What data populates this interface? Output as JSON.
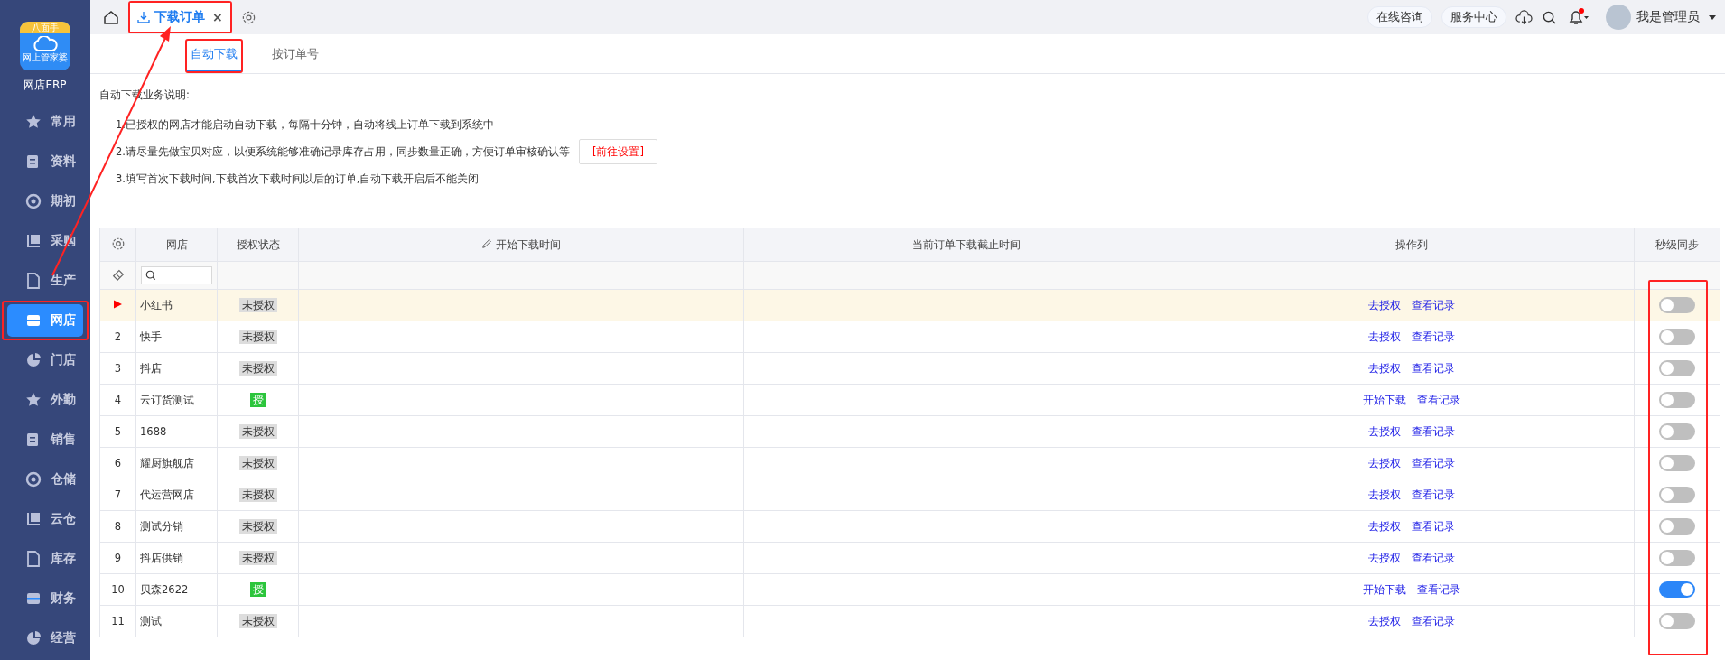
{
  "sidebar": {
    "logo": {
      "badge": "八面手",
      "caption": "网上管家婆"
    },
    "app_name": "网店ERP",
    "items": [
      {
        "label": "常用",
        "selected": false,
        "highlighted": false
      },
      {
        "label": "资料",
        "selected": false,
        "highlighted": false
      },
      {
        "label": "期初",
        "selected": false,
        "highlighted": false
      },
      {
        "label": "采购",
        "selected": false,
        "highlighted": false
      },
      {
        "label": "生产",
        "selected": false,
        "highlighted": false
      },
      {
        "label": "网店",
        "selected": true,
        "highlighted": true
      },
      {
        "label": "门店",
        "selected": false,
        "highlighted": false
      },
      {
        "label": "外勤",
        "selected": false,
        "highlighted": false
      },
      {
        "label": "销售",
        "selected": false,
        "highlighted": false
      },
      {
        "label": "仓储",
        "selected": false,
        "highlighted": false
      },
      {
        "label": "云仓",
        "selected": false,
        "highlighted": false
      },
      {
        "label": "库存",
        "selected": false,
        "highlighted": false
      },
      {
        "label": "财务",
        "selected": false,
        "highlighted": false
      },
      {
        "label": "经营",
        "selected": false,
        "highlighted": false
      }
    ]
  },
  "header": {
    "tabs": [
      {
        "label": "下载订单",
        "close": "×",
        "selected": true,
        "highlighted": true
      }
    ],
    "buttons": [
      "在线咨询",
      "服务中心"
    ],
    "notification_dot": true,
    "user": "我是管理员"
  },
  "subtabs": [
    {
      "label": "自动下载",
      "selected": true,
      "highlighted": true
    },
    {
      "label": "按订单号",
      "selected": false,
      "highlighted": false
    }
  ],
  "instructions": {
    "title": "自动下载业务说明:",
    "items": [
      {
        "text": "1.已授权的网店才能启动自动下载，每隔十分钟，自动将线上订单下载到系统中"
      },
      {
        "text": "2.请尽量先做宝贝对应，以便系统能够准确记录库存占用，同步数量正确，方便订单审核确认等",
        "button": "[前往设置]"
      },
      {
        "text": "3.填写首次下载时间,下载首次下载时间以后的订单,自动下载开启后不能关闭"
      }
    ]
  },
  "table": {
    "columns": [
      "网店",
      "授权状态",
      "开始下载时间",
      "当前订单下载截止时间",
      "操作列",
      "秒级同步"
    ],
    "sync_highlighted": true,
    "rows": [
      {
        "selected": true,
        "shop": "小红书",
        "status": "未授权",
        "authorized": false,
        "actions": [
          "去授权",
          "查看记录"
        ],
        "on": false
      },
      {
        "selected": false,
        "index": "2",
        "shop": "快手",
        "status": "未授权",
        "authorized": false,
        "actions": [
          "去授权",
          "查看记录"
        ],
        "on": false
      },
      {
        "selected": false,
        "index": "3",
        "shop": "抖店",
        "status": "未授权",
        "authorized": false,
        "actions": [
          "去授权",
          "查看记录"
        ],
        "on": false
      },
      {
        "selected": false,
        "index": "4",
        "shop": "云订货测试",
        "status": "授",
        "authorized": true,
        "actions": [
          "开始下载",
          "查看记录"
        ],
        "on": false
      },
      {
        "selected": false,
        "index": "5",
        "shop": "1688",
        "status": "未授权",
        "authorized": false,
        "actions": [
          "去授权",
          "查看记录"
        ],
        "on": false
      },
      {
        "selected": false,
        "index": "6",
        "shop": "耀厨旗舰店",
        "status": "未授权",
        "authorized": false,
        "actions": [
          "去授权",
          "查看记录"
        ],
        "on": false
      },
      {
        "selected": false,
        "index": "7",
        "shop": "代运营网店",
        "status": "未授权",
        "authorized": false,
        "actions": [
          "去授权",
          "查看记录"
        ],
        "on": false
      },
      {
        "selected": false,
        "index": "8",
        "shop": "测试分销",
        "status": "未授权",
        "authorized": false,
        "actions": [
          "去授权",
          "查看记录"
        ],
        "on": false
      },
      {
        "selected": false,
        "index": "9",
        "shop": "抖店供销",
        "status": "未授权",
        "authorized": false,
        "actions": [
          "去授权",
          "查看记录"
        ],
        "on": false
      },
      {
        "selected": false,
        "index": "10",
        "shop": "贝森2622",
        "status": "授",
        "authorized": true,
        "actions": [
          "开始下载",
          "查看记录"
        ],
        "on": true
      },
      {
        "selected": false,
        "index": "11",
        "shop": "测试",
        "status": "未授权",
        "authorized": false,
        "actions": [
          "去授权",
          "查看记录"
        ],
        "on": false
      }
    ]
  },
  "annotations": [
    {
      "kind": "arrow"
    }
  ]
}
